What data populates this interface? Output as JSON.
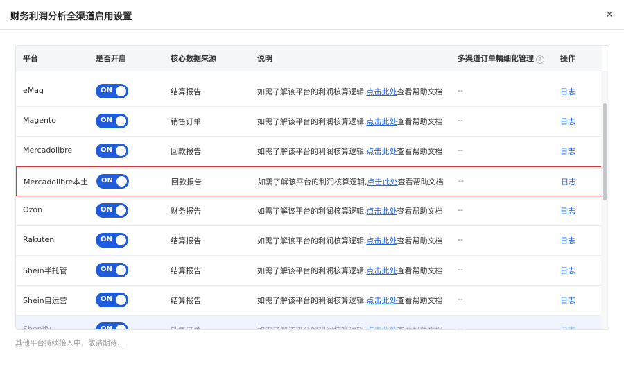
{
  "dialog": {
    "title": "财务利润分析全渠道启用设置",
    "close_glyph": "×"
  },
  "table": {
    "headers": {
      "platform": "平台",
      "enabled": "是否开启",
      "source": "核心数据来源",
      "description": "说明",
      "fine_management": "多渠道订单精细化管理",
      "help_glyph": "?",
      "actions": "操作"
    },
    "rows": [
      {
        "platform": "eMag",
        "toggle": "ON",
        "source": "结算报告",
        "desc_prefix": "如需了解该平台的利润核算逻辑,",
        "desc_link": "点击此处",
        "desc_suffix": "查看帮助文档",
        "fine": "--",
        "log": "日志"
      },
      {
        "platform": "Magento",
        "toggle": "ON",
        "source": "销售订单",
        "desc_prefix": "如需了解该平台的利润核算逻辑,",
        "desc_link": "点击此处",
        "desc_suffix": "查看帮助文档",
        "fine": "--",
        "log": "日志"
      },
      {
        "platform": "Mercadolibre",
        "toggle": "ON",
        "source": "回款报告",
        "desc_prefix": "如需了解该平台的利润核算逻辑,",
        "desc_link": "点击此处",
        "desc_suffix": "查看帮助文档",
        "fine": "--",
        "log": "日志"
      },
      {
        "platform": "Mercadolibre本土",
        "toggle": "ON",
        "source": "回款报告",
        "desc_prefix": "如需了解该平台的利润核算逻辑,",
        "desc_link": "点击此处",
        "desc_suffix": "查看帮助文档",
        "fine": "--",
        "log": "日志"
      },
      {
        "platform": "Ozon",
        "toggle": "ON",
        "source": "财务报告",
        "desc_prefix": "如需了解该平台的利润核算逻辑,",
        "desc_link": "点击此处",
        "desc_suffix": "查看帮助文档",
        "fine": "--",
        "log": "日志"
      },
      {
        "platform": "Rakuten",
        "toggle": "ON",
        "source": "结算报告",
        "desc_prefix": "如需了解该平台的利润核算逻辑,",
        "desc_link": "点击此处",
        "desc_suffix": "查看帮助文档",
        "fine": "--",
        "log": "日志"
      },
      {
        "platform": "Shein半托管",
        "toggle": "ON",
        "source": "结算报告",
        "desc_prefix": "如需了解该平台的利润核算逻辑,",
        "desc_link": "点击此处",
        "desc_suffix": "查看帮助文档",
        "fine": "--",
        "log": "日志"
      },
      {
        "platform": "Shein自运营",
        "toggle": "ON",
        "source": "结算报告",
        "desc_prefix": "如需了解该平台的利润核算逻辑,",
        "desc_link": "点击此处",
        "desc_suffix": "查看帮助文档",
        "fine": "--",
        "log": "日志"
      },
      {
        "platform": "Shopify",
        "toggle": "ON",
        "source": "销售订单",
        "desc_prefix": "如需了解该平台的利润核算逻辑,",
        "desc_link": "点击此处",
        "desc_suffix": "查看帮助文档",
        "fine": "--",
        "log": "日志"
      }
    ]
  },
  "footer": {
    "note": "其他平台持续接入中，敬请期待..."
  }
}
